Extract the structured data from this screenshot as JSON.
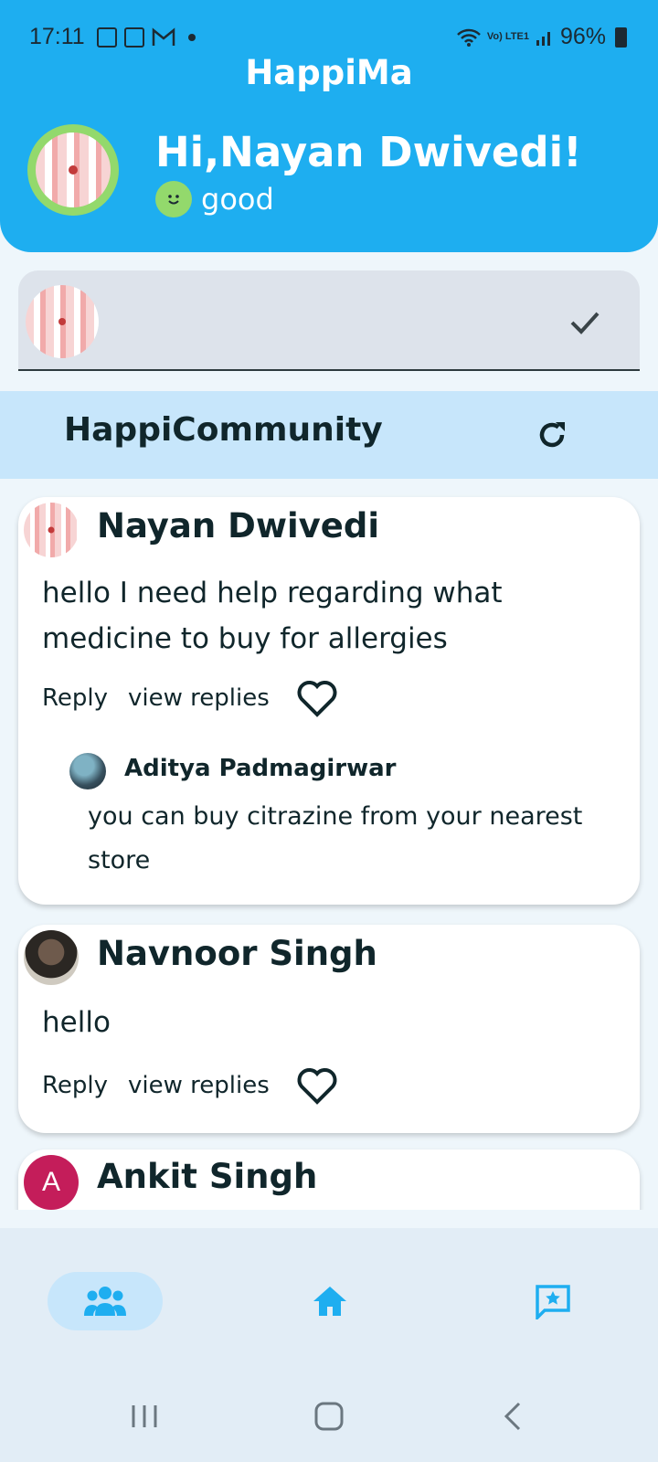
{
  "status_bar": {
    "time": "17:11",
    "network_label": "Vo) LTE1",
    "battery": "96%"
  },
  "header": {
    "app_title": "HappiMa",
    "greeting": "Hi,Nayan Dwivedi!",
    "mood": "good",
    "mood_icon": "smiley-icon"
  },
  "compose": {
    "submit_icon": "check-icon"
  },
  "community": {
    "title": "HappiCommunity",
    "refresh_icon": "refresh-icon"
  },
  "posts": [
    {
      "author": "Nayan Dwivedi",
      "message": "hello I need help regarding what medicine to buy for allergies",
      "reply_label": "Reply",
      "view_replies_label": "view replies",
      "replies": [
        {
          "author": "Aditya Padmagirwar",
          "message": "you can buy citrazine from your nearest store"
        }
      ]
    },
    {
      "author": "Navnoor Singh",
      "message": "hello",
      "reply_label": "Reply",
      "view_replies_label": "view replies",
      "replies": []
    },
    {
      "author": "Ankit Singh",
      "avatar_letter": "A"
    }
  ],
  "bottom_nav": {
    "items": [
      {
        "icon": "community-icon",
        "active": true
      },
      {
        "icon": "home-icon",
        "active": false
      },
      {
        "icon": "feedback-icon",
        "active": false
      }
    ]
  },
  "colors": {
    "primary": "#1eaef0",
    "accent_green": "#93d96c",
    "light_blue": "#c7e6fb"
  }
}
